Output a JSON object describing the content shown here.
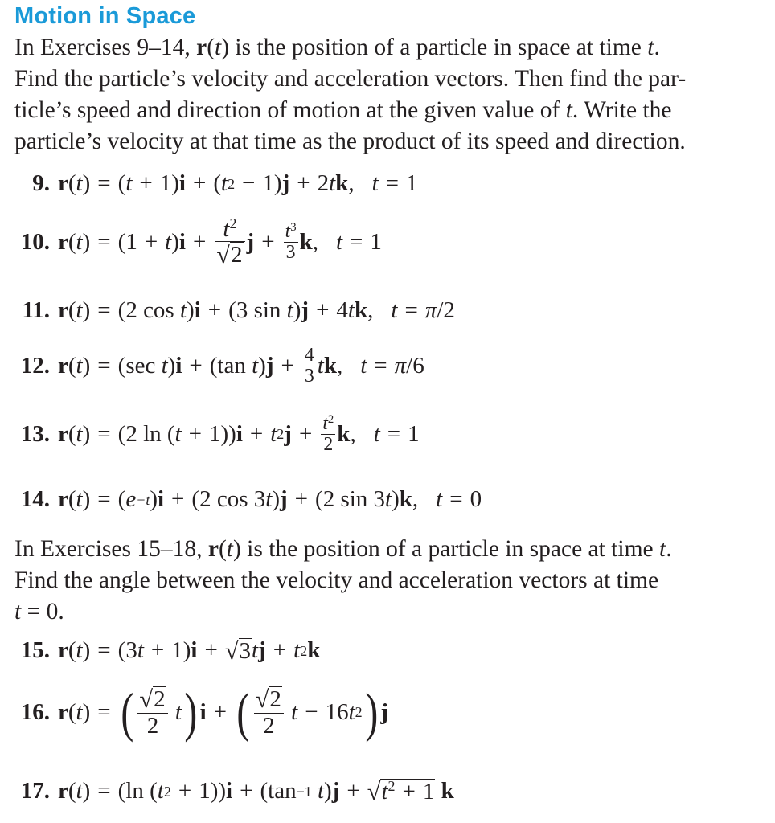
{
  "section_title": "Motion in Space",
  "intro_1": {
    "lines": [
      [
        "In Exercises 9–14, ",
        "r",
        "(",
        "t",
        ") is the position of a particle in space at time ",
        "t",
        "."
      ],
      [
        "Find the particle’s velocity and acceleration vectors. Then find the par-"
      ],
      [
        "ticle’s speed and direction of motion at the given value of ",
        "t",
        ". Write the"
      ],
      [
        "particle’s velocity at that time as the product of its speed and direction."
      ]
    ]
  },
  "exercises_a": [
    {
      "number": "9.",
      "r": "r",
      "t": "t",
      "expr": "(t + 1)i + (t² − 1)j + 2tk",
      "at": "t = 1"
    },
    {
      "number": "10.",
      "r": "r",
      "t": "t",
      "expr": "(1 + t)i + (t²/√2)j + (t³/3)k",
      "at": "t = 1"
    },
    {
      "number": "11.",
      "r": "r",
      "t": "t",
      "expr": "(2 cos t)i + (3 sin t)j + 4tk",
      "at": "t = π/2"
    },
    {
      "number": "12.",
      "r": "r",
      "t": "t",
      "expr": "(sec t)i + (tan t)j + (4/3)tk",
      "at": "t = π/6"
    },
    {
      "number": "13.",
      "r": "r",
      "t": "t",
      "expr": "(2 ln (t + 1))i + t²j + (t²/2)k",
      "at": "t = 1"
    },
    {
      "number": "14.",
      "r": "r",
      "t": "t",
      "expr": "(e^−t)i + (2 cos 3t)j + (2 sin 3t)k",
      "at": "t = 0"
    }
  ],
  "intro_2": {
    "lines": [
      [
        "In Exercises 15–18, ",
        "r",
        "(",
        "t",
        ") is the position of a particle in space at time ",
        "t",
        "."
      ],
      [
        "Find the angle between the velocity and acceleration vectors at time"
      ],
      [
        "t",
        " = 0."
      ]
    ]
  },
  "exercises_b": [
    {
      "number": "15.",
      "expr": "(3t + 1)i + √3tj + t²k"
    },
    {
      "number": "16.",
      "expr": "((√2/2)t)i + ((√2/2)t − 16t²)j"
    },
    {
      "number": "17.",
      "expr": "(ln (t² + 1))i + (tan⁻¹ t)j + √(t² + 1) k"
    }
  ],
  "tokens": {
    "eq": "=",
    "plus": "+",
    "minus": "−",
    "comma": ",",
    "lp": "(",
    "rp": ")",
    "i": "i",
    "j": "j",
    "k": "k",
    "two": "2",
    "three": "3",
    "four": "4",
    "one": "1",
    "zero": "0",
    "six": "6",
    "sixteen": "16",
    "pi": "π",
    "slash": "/",
    "sqrt": "√",
    "cos": "cos",
    "sin": "sin",
    "sec": "sec",
    "tan": "tan",
    "ln": "ln",
    "e": "e",
    "neg_t": "−t",
    "inv": "−1",
    "sq": "2",
    "cube": "3"
  }
}
